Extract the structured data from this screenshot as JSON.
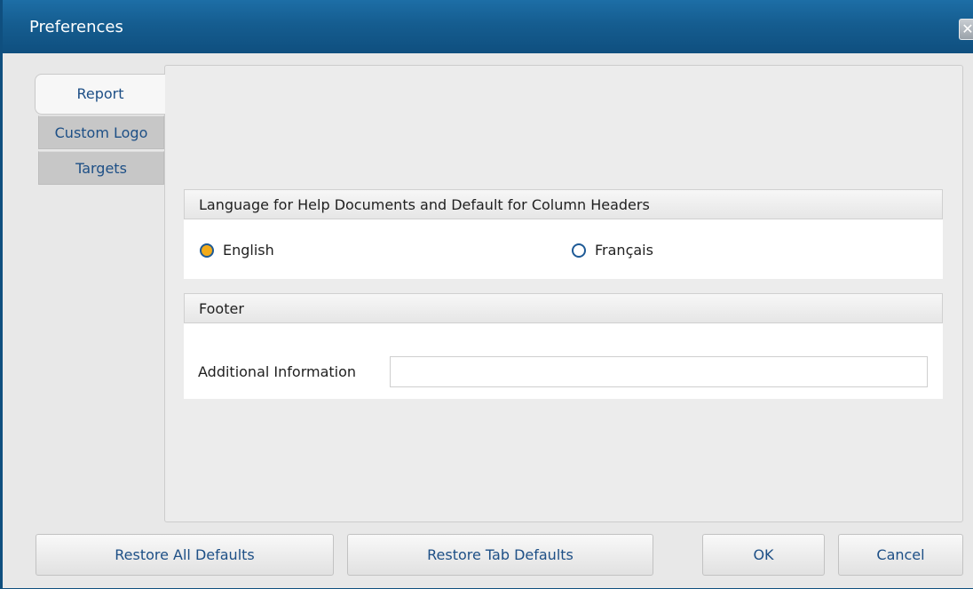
{
  "window": {
    "title": "Preferences",
    "close_glyph": "✕"
  },
  "tabs": [
    {
      "label": "Report",
      "active": true
    },
    {
      "label": "Custom Logo",
      "active": false
    },
    {
      "label": "Targets",
      "active": false
    }
  ],
  "language_section": {
    "header": "Language for Help Documents and Default for Column Headers",
    "options": [
      {
        "label": "English",
        "checked": true
      },
      {
        "label": "Français",
        "checked": false
      }
    ]
  },
  "footer_section": {
    "header": "Footer",
    "field_label": "Additional Information",
    "field_value": ""
  },
  "buttons": {
    "restore_all": "Restore All Defaults",
    "restore_tab": "Restore Tab Defaults",
    "ok": "OK",
    "cancel": "Cancel"
  },
  "colors": {
    "titlebar": "#155d90",
    "link_text": "#1d4f86",
    "radio_selected": "#f2ab1a"
  }
}
